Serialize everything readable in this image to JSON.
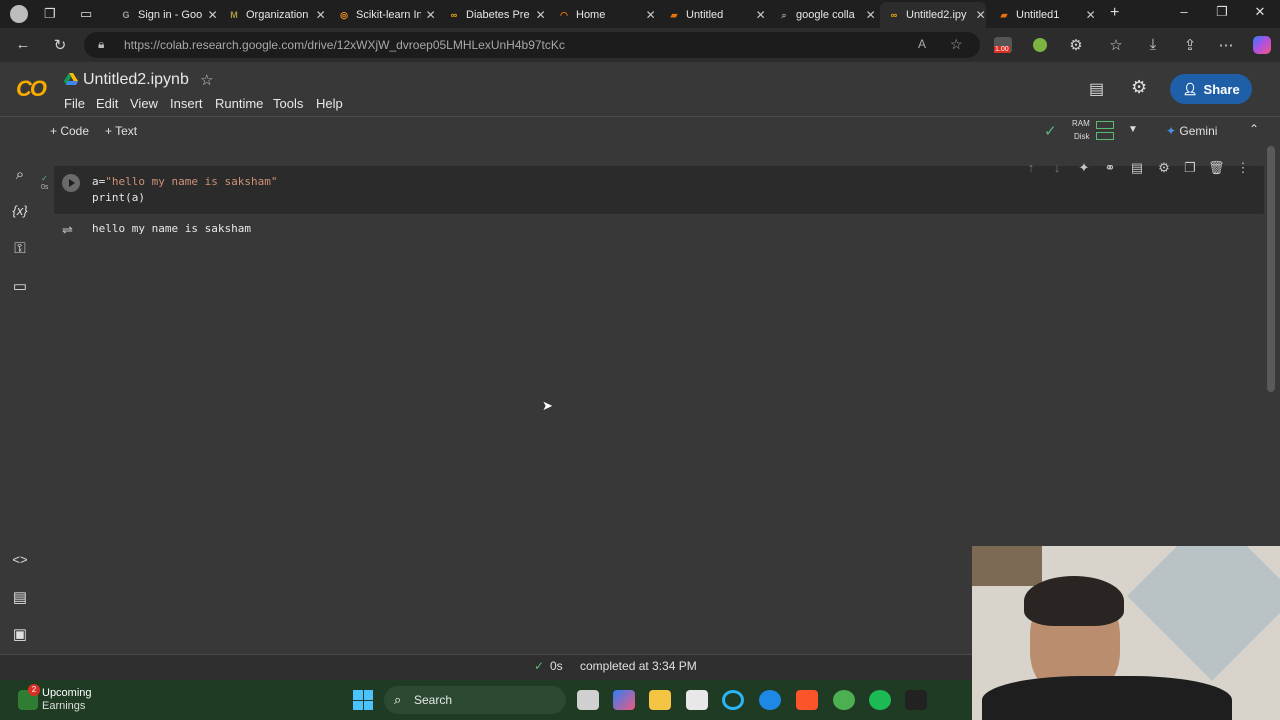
{
  "browser": {
    "tabs": [
      {
        "title": "Sign in - Goo",
        "color": "#9aa0a6",
        "glyph": "G"
      },
      {
        "title": "Organization",
        "color": "#a89a3c",
        "glyph": "M"
      },
      {
        "title": "Scikit-learn In",
        "color": "#f7931e",
        "glyph": "◎"
      },
      {
        "title": "Diabetes Pre",
        "color": "#f9ab00",
        "glyph": "∞"
      },
      {
        "title": "Home",
        "color": "#e8710a",
        "glyph": "◠"
      },
      {
        "title": "Untitled",
        "color": "#e8710a",
        "glyph": "▰"
      },
      {
        "title": "google colla",
        "color": "#9aa0a6",
        "glyph": "⌕"
      },
      {
        "title": "Untitled2.ipy",
        "color": "#f9ab00",
        "glyph": "∞"
      },
      {
        "title": "Untitled1",
        "color": "#e8710a",
        "glyph": "▰"
      }
    ],
    "active_tab_index": 7,
    "url": "https://colab.research.google.com/drive/12xWXjW_dvroep05LMHLexUnH4b97tcKc",
    "zoom_badge": "1.00"
  },
  "colab": {
    "filename": "Untitled2.ipynb",
    "menu": [
      "File",
      "Edit",
      "View",
      "Insert",
      "Runtime",
      "Tools",
      "Help"
    ],
    "share_label": "Share",
    "toolbar": {
      "code_label": "+ Code",
      "text_label": "+ Text",
      "ram_label": "RAM",
      "disk_label": "Disk",
      "gemini_label": "Gemini"
    },
    "cell": {
      "exec_time": "0s",
      "code_line1_prefix": "a=",
      "code_line1_string": "\"hello my name is saksham\"",
      "code_line2": "print(a)",
      "output": "hello my name is saksham"
    },
    "status": {
      "check": "✓",
      "time": "0s",
      "completed": "completed at 3:34 PM"
    }
  },
  "taskbar": {
    "widget_badge": "2",
    "widget_title": "Upcoming",
    "widget_subtitle": "Earnings",
    "search_label": "Search"
  }
}
